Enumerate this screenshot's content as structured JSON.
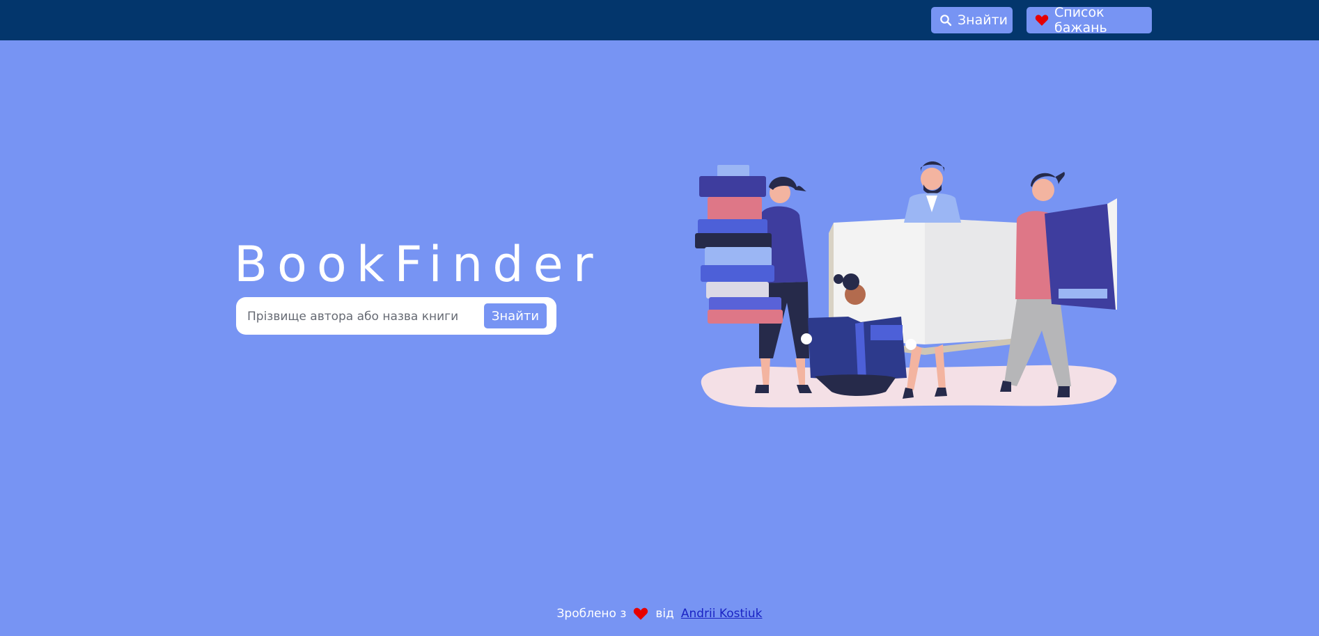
{
  "nav": {
    "find_label": "Знайти",
    "wishlist_label": "Список бажань"
  },
  "hero": {
    "title": "BookFinder",
    "search_placeholder": "Прізвище автора або назва книги",
    "search_value": "",
    "search_button": "Знайти"
  },
  "footer": {
    "made_with": "Зроблено з",
    "by": "від",
    "author_link": "Andrii Kostiuk"
  },
  "colors": {
    "page_bg": "#7794f3",
    "topbar_bg": "#03366c",
    "heart": "#e60000",
    "link": "#1a24c4"
  },
  "icons": {
    "search": "search-icon",
    "heart": "heart-icon"
  }
}
